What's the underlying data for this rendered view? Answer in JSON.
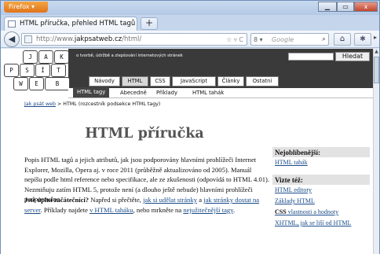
{
  "browser": {
    "menu_label": "Firefox ▾",
    "tab_title": "HTML příručka, přehled HTML tagů",
    "new_tab": "+",
    "url_prefix": "http://www.",
    "url_domain": "jakpsatweb.cz",
    "url_path": "/html/",
    "search_engine": "8 ▾",
    "search_placeholder": "Google",
    "window_min": "▁",
    "window_max": "▭",
    "window_close": "x"
  },
  "site": {
    "tagline": "o tvorbě, údržbě a zlepšování internetových stránek",
    "search_button": "Hledat",
    "logo_keys": [
      "J",
      "A",
      "K",
      "P",
      "S",
      "Í",
      "T",
      "W",
      "E",
      "B"
    ],
    "menu": [
      "Návody",
      "HTML",
      "CSS",
      "JavaScript",
      "Články",
      "Ostatní"
    ],
    "subnav": [
      "HTML tagy",
      "Abecedně",
      "Příklady",
      "HTML tahák"
    ],
    "breadcrumb": {
      "link": "Jak psát web",
      "sep": " > ",
      "current": "HTML",
      "note": "  (rozcestník podsekce HTML tagy)"
    }
  },
  "article": {
    "title": "HTML příručka",
    "intro": "Popis HTML tagů a jejich atributů, jak jsou podporovány hlavními prohlížeči Internet Explorer, Mozilla, Opera aj. v roce 2011 (průběžně aktualizováno od 2005). Manuál nepíšu podle html reference nebo specifikace, ale ze zkušenosti (odpovídá to HTML 4.01). Nezmiňuju zatím HTML 5, protože není (a dlouho ještě nebude) hlavními prohlížeči podporováno.",
    "beginner_lead": "Jste úplní začátečníci?",
    "beginner_text1": " Napřed si přečtěte, ",
    "beginner_link1": "jak si udělat stránky",
    "beginner_text2": " a ",
    "beginner_link2": "jak stránky dostat na server",
    "beginner_text3": ". Příklady najdete ",
    "beginner_link3": "v HTML taháku",
    "beginner_text4": ", nebo mrkněte na ",
    "beginner_link4": "nejužitečnější tagy",
    "beginner_text5": "."
  },
  "sidebar": {
    "popular_title": "Nejoblíbenější:",
    "popular_links": [
      "HTML tahák"
    ],
    "see_also_title": "Vizte též:",
    "see_also_links": [
      "HTML editory",
      "Základy HTML"
    ],
    "css_bold": "CSS",
    "css_rest": " vlastnosti a hodnoty",
    "xhtml_link": "XHTML, jak se liší od HTML"
  }
}
